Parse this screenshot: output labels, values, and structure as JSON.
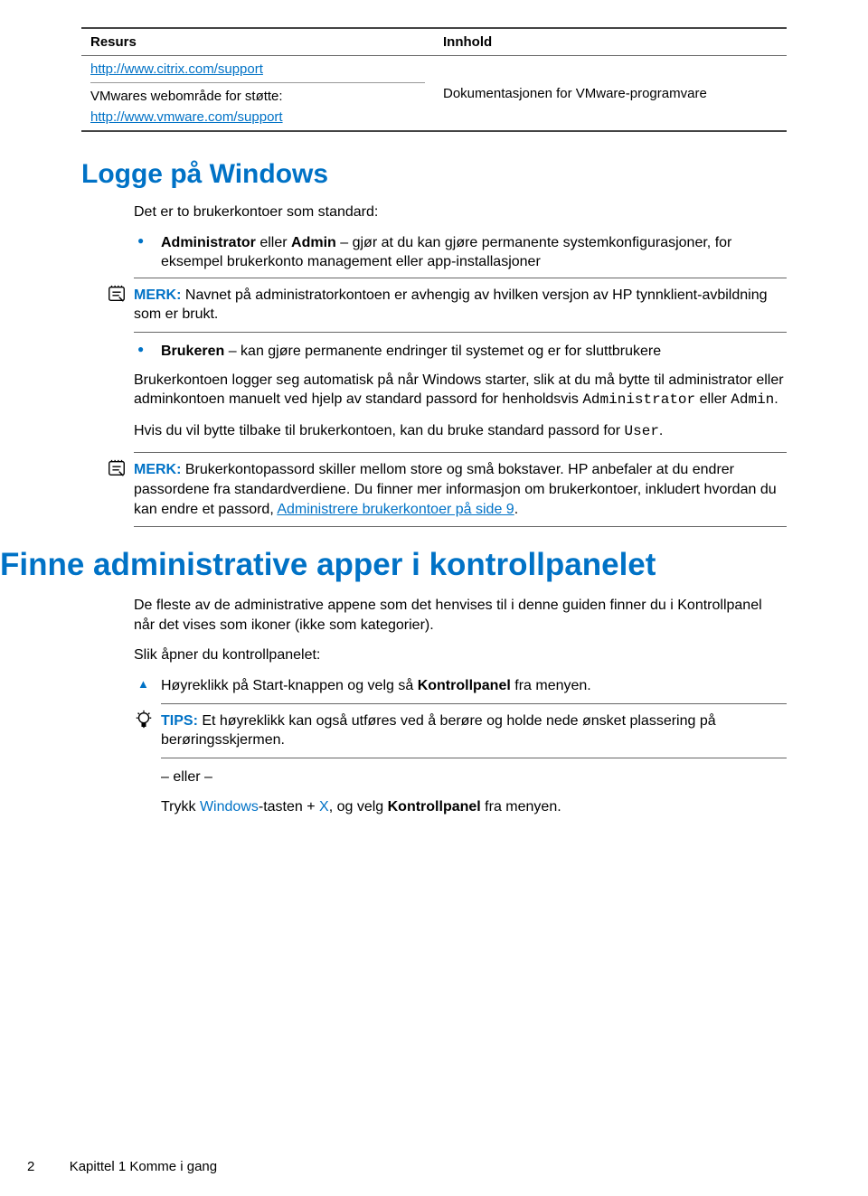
{
  "table": {
    "headers": [
      "Resurs",
      "Innhold"
    ],
    "rows": [
      {
        "cells": [
          "http://www.citrix.com/support",
          ""
        ],
        "link": true
      },
      {
        "cells": [
          "VMwares webområde for støtte:",
          "Dokumentasjonen for VMware-programvare"
        ],
        "link": false
      },
      {
        "cells": [
          "http://www.vmware.com/support",
          ""
        ],
        "link": true
      }
    ]
  },
  "section1": {
    "title": "Logge på Windows",
    "intro": "Det er to brukerkontoer som standard:",
    "bullets": {
      "admin_b": "Administrator",
      "admin_b2": "Admin",
      "admin_text_pre": " eller ",
      "admin_text_post": " – gjør at du kan gjøre permanente systemkonfigurasjoner, for eksempel brukerkonto management eller app-installasjoner",
      "note_label": "MERK:",
      "note_text": "   Navnet på administratorkontoen er avhengig av hvilken versjon av HP tynnklient-avbildning som er brukt.",
      "user_b": "Brukeren",
      "user_text": " – kan gjøre permanente endringer til systemet og er for sluttbrukere"
    },
    "para2a": "Brukerkontoen logger seg automatisk på når Windows starter, slik at du må bytte til administrator eller adminkontoen manuelt ved hjelp av standard passord for henholdsvis ",
    "para2_code1": "Administrator",
    "para2_mid": " eller ",
    "para2_code2": "Admin",
    "para2_end": ".",
    "para3a": "Hvis du vil bytte tilbake til brukerkontoen, kan du bruke standard passord for ",
    "para3_code": "User",
    "para3_end": ".",
    "note2_label": "MERK:",
    "note2_text": "   Brukerkontopassord skiller mellom store og små bokstaver. HP anbefaler at du endrer passordene fra standardverdiene. Du finner mer informasjon om brukerkontoer, inkludert hvordan du kan endre et passord, ",
    "note2_link": "Administrere brukerkontoer på side 9",
    "note2_after": "."
  },
  "section2": {
    "title": "Finne administrative apper i kontrollpanelet",
    "para1": "De fleste av de administrative appene som det henvises til i denne guiden finner du i Kontrollpanel når det vises som ikoner (ikke som kategorier).",
    "para2": "Slik åpner du kontrollpanelet:",
    "step1a": "Høyreklikk på Start-knappen og velg så ",
    "step1_b": "Kontrollpanel",
    "step1c": " fra menyen.",
    "tip_label": "TIPS:",
    "tip_text": "   Et høyreklikk kan også utføres ved å berøre og holde nede ønsket plassering på berøringsskjermen.",
    "eller": "– eller –",
    "step2a": "Trykk ",
    "step2_key1": "Windows",
    "step2_mid": "-tasten + ",
    "step2_key2": "X",
    "step2_end": ", og velg ",
    "step2_b": "Kontrollpanel",
    "step2_after": " fra menyen."
  },
  "footer": {
    "page": "2",
    "chapter": "Kapittel 1   Komme i gang"
  }
}
